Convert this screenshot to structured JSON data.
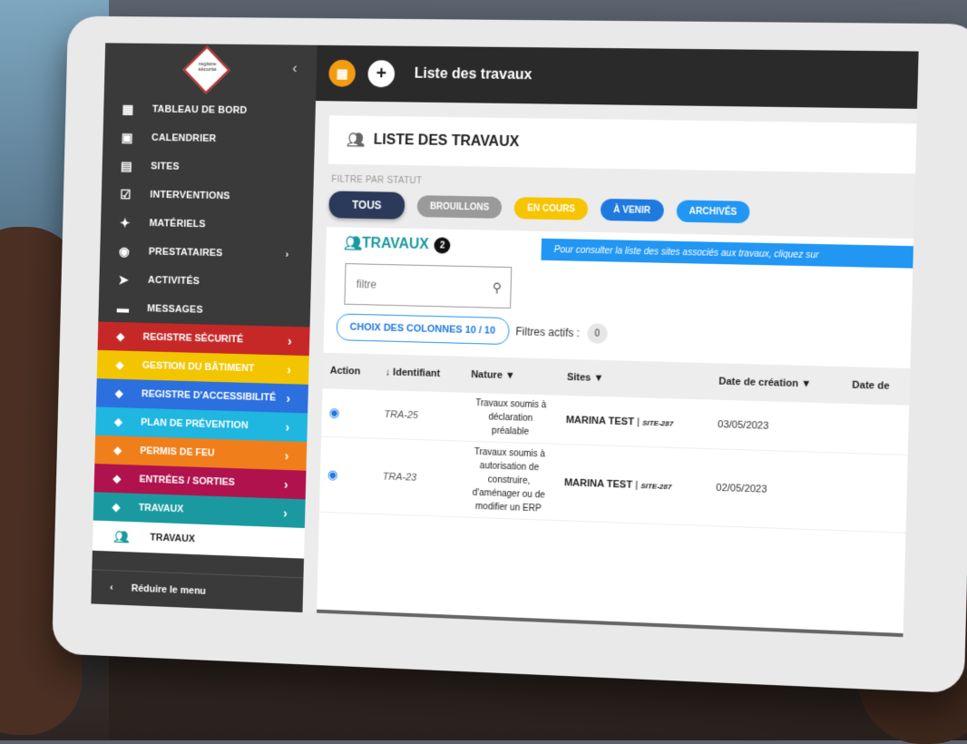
{
  "sidebar": {
    "logo_text": "registre sécurité",
    "items": [
      {
        "label": "TABLEAU DE BORD",
        "icon": "dashboard-icon"
      },
      {
        "label": "CALENDRIER",
        "icon": "calendar-icon"
      },
      {
        "label": "SITES",
        "icon": "clipboard-icon"
      },
      {
        "label": "INTERVENTIONS",
        "icon": "checklist-icon"
      },
      {
        "label": "MATÉRIELS",
        "icon": "lightbulb-icon"
      },
      {
        "label": "PRESTATAIRES",
        "icon": "user-circle-icon"
      },
      {
        "label": "ACTIVITÉS",
        "icon": "tag-icon"
      },
      {
        "label": "MESSAGES",
        "icon": "message-icon"
      }
    ],
    "modules": [
      {
        "label": "REGISTRE SÉCURITÉ",
        "color": "#c62828"
      },
      {
        "label": "GESTION DU BÂTIMENT",
        "color": "#f2c500"
      },
      {
        "label": "REGISTRE D'ACCESSIBILITÉ",
        "color": "#2c6fde"
      },
      {
        "label": "PLAN DE PRÉVENTION",
        "color": "#1fb6e0"
      },
      {
        "label": "PERMIS DE FEU",
        "color": "#f07f1b"
      },
      {
        "label": "ENTRÉES / SORTIES",
        "color": "#b0124e"
      },
      {
        "label": "TRAVAUX",
        "color": "#1a9aa0"
      }
    ],
    "sub_item": "TRAVAUX",
    "reduce_label": "Réduire le menu"
  },
  "topbar": {
    "title": "Liste des travaux"
  },
  "header": {
    "title": "LISTE DES TRAVAUX"
  },
  "filters": {
    "label": "FILTRE PAR STATUT",
    "statuses": [
      "TOUS",
      "BROUILLONS",
      "EN COURS",
      "À VENIR",
      "ARCHIVÉS"
    ]
  },
  "travaux": {
    "title": "TRAVAUX",
    "count": "2",
    "info": "Pour consulter la liste des sites associés aux travaux, cliquez sur",
    "search_placeholder": "filtre",
    "columns_button": "CHOIX DES COLONNES 10 / 10",
    "active_filters_label": "Filtres actifs :",
    "active_filters_count": "0",
    "headers": [
      "Action",
      "↓ Identifiant",
      "Nature",
      "Sites",
      "Date de création",
      "Date de"
    ],
    "rows": [
      {
        "id": "TRA-25",
        "nature": "Travaux soumis à déclaration préalable",
        "site": "MARINA TEST",
        "site_code": "SITE-287",
        "date": "03/05/2023"
      },
      {
        "id": "TRA-23",
        "nature": "Travaux soumis à autorisation de construire, d'aménager ou de modifier un ERP",
        "site": "MARINA TEST",
        "site_code": "SITE-287",
        "date": "02/05/2023"
      }
    ]
  }
}
